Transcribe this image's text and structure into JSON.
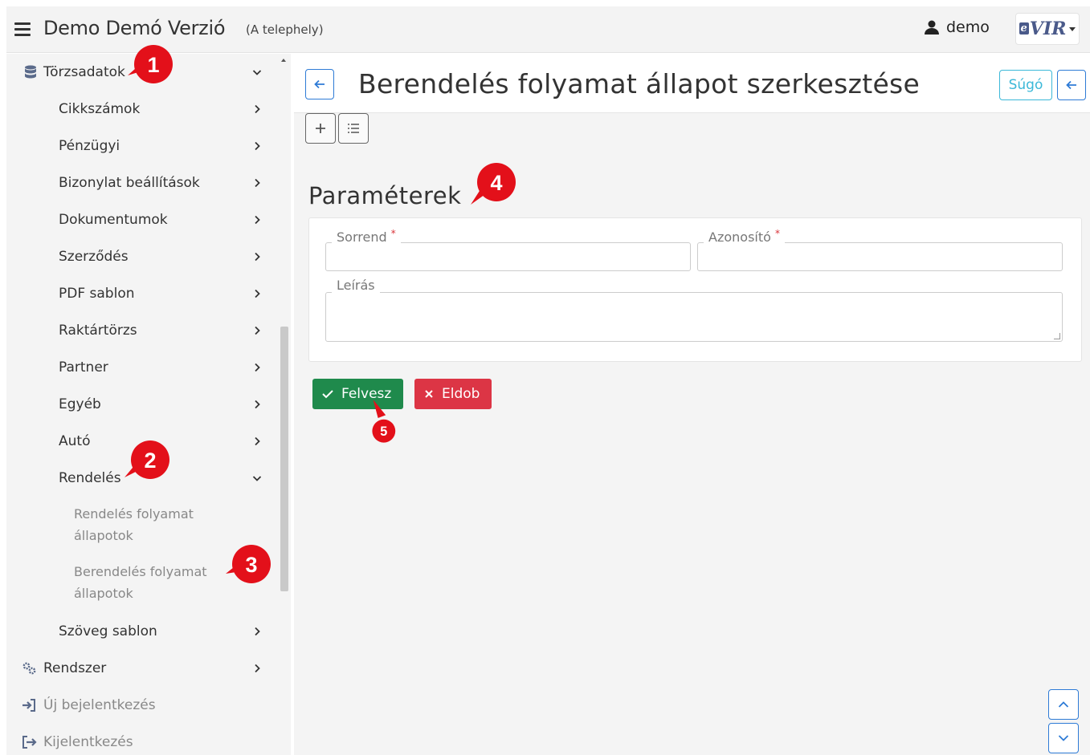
{
  "header": {
    "app_title": "Demo Demó Verzió",
    "site": "(A telephely)",
    "user": "demo",
    "logo_text": "VIR",
    "logo_e": "e"
  },
  "sidebar": {
    "section": "Törzsadatok",
    "items": [
      {
        "label": "Cikkszámok"
      },
      {
        "label": "Pénzügyi"
      },
      {
        "label": "Bizonylat beállítások"
      },
      {
        "label": "Dokumentumok"
      },
      {
        "label": "Szerződés"
      },
      {
        "label": "PDF sablon"
      },
      {
        "label": "Raktártörzs"
      },
      {
        "label": "Partner"
      },
      {
        "label": "Egyéb"
      },
      {
        "label": "Autó"
      },
      {
        "label": "Rendelés"
      }
    ],
    "sub_items": [
      {
        "label": "Rendelés folyamat állapotok"
      },
      {
        "label": "Berendelés folyamat állapotok"
      }
    ],
    "text_template": "Szöveg sablon",
    "system": "Rendszer",
    "new_login": "Új bejelentkezés",
    "logout": "Kijelentkezés"
  },
  "main": {
    "title": "Berendelés folyamat állapot szerkesztése",
    "help_label": "Súgó",
    "section_title": "Paraméterek",
    "fields": {
      "order_label": "Sorrend",
      "id_label": "Azonosító",
      "desc_label": "Leírás",
      "required_mark": "*"
    },
    "save_label": "Felvesz",
    "discard_label": "Eldob"
  },
  "callouts": [
    "1",
    "2",
    "3",
    "4",
    "5"
  ],
  "colors": {
    "accent": "#2e7bd6",
    "help": "#3bb8d8",
    "success": "#1f8a4c",
    "danger": "#dc3545",
    "callout": "#e3101a"
  }
}
